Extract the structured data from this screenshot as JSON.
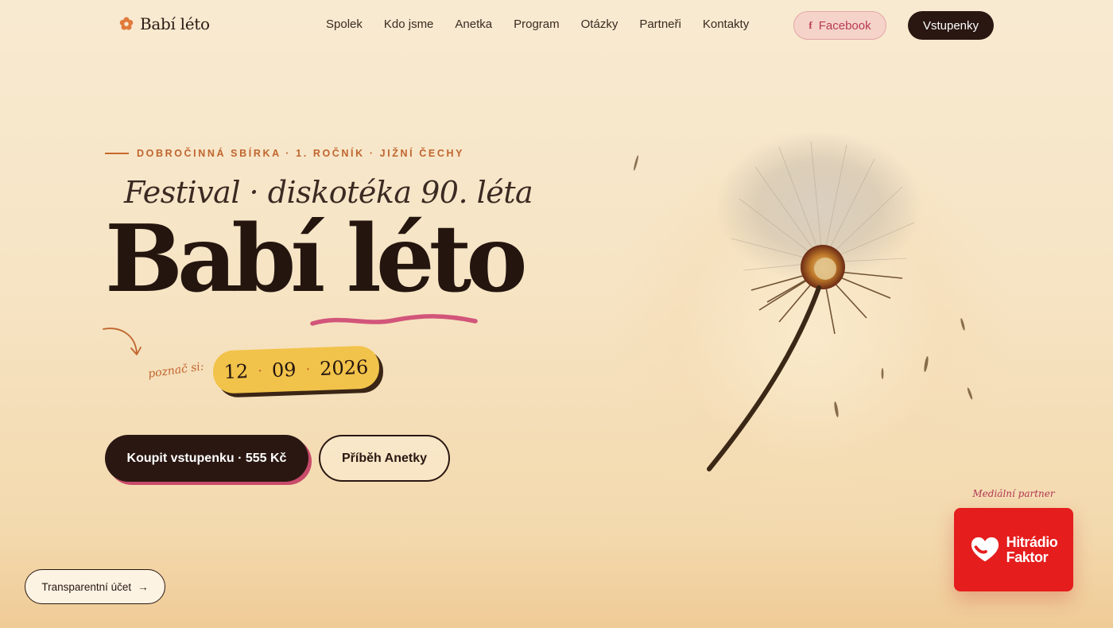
{
  "nav": {
    "brand": "Babí léto",
    "links": [
      {
        "label": "Spolek"
      },
      {
        "label": "Kdo jsme"
      },
      {
        "label": "Anetka"
      },
      {
        "label": "Program"
      },
      {
        "label": "Otázky"
      },
      {
        "label": "Partneři"
      },
      {
        "label": "Kontakty"
      }
    ],
    "facebook_label": "Facebook",
    "tickets_label": "Vstupenky"
  },
  "hero": {
    "eyebrow": "DOBROČINNÁ SBÍRKA · 1. ROČNÍK · JIŽNÍ ČECHY",
    "subtitle": "Festival · diskotéka 90. léta",
    "title": "Babí léto",
    "remember_label": "poznač si:",
    "date": {
      "day": "12",
      "month": "09",
      "year": "2026"
    },
    "buy_button": "Koupit vstupenku · 555 Kč",
    "story_button": "Příběh Anetky"
  },
  "footer_link": {
    "label": "Transparentní účet",
    "arrow": "→"
  },
  "media_partner": {
    "label": "Mediální partner",
    "line1": "Hitrádio",
    "line2": "Faktor"
  },
  "icons": {
    "brand": "flower-icon",
    "facebook": "facebook-icon",
    "arrow": "arrow-right-icon",
    "partner": "heart-logo-icon"
  },
  "colors": {
    "accent": "#c0652e",
    "dark": "#2a1712",
    "date_pill": "#f2c34a",
    "pink": "#c84b6a",
    "partner_red": "#e51d1d"
  }
}
